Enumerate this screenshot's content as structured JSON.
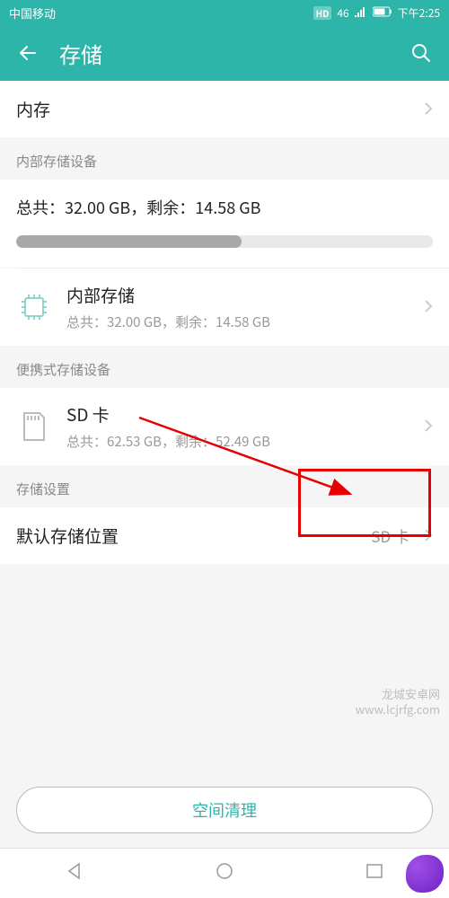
{
  "statusBar": {
    "carrier": "中国移动",
    "hd": "HD",
    "signal": "46",
    "time": "下午2:25"
  },
  "appBar": {
    "title": "存储"
  },
  "memoryRow": {
    "label": "内存"
  },
  "internalSection": {
    "header": "内部存储设备",
    "summary": "总共：32.00 GB，剩余：14.58 GB",
    "usedPercent": 54,
    "item": {
      "title": "内部存储",
      "sub": "总共：32.00 GB，剩余：14.58 GB"
    }
  },
  "portableSection": {
    "header": "便携式存储设备",
    "item": {
      "title": "SD 卡",
      "sub": "总共：62.53 GB，剩余：52.49 GB"
    }
  },
  "settingsSection": {
    "header": "存储设置",
    "defaultLocation": {
      "label": "默认存储位置",
      "value": "SD 卡"
    }
  },
  "cleanupButton": "空间清理",
  "watermark": {
    "line1": "龙城安卓网",
    "line2": "www.lcjrfg.com"
  }
}
